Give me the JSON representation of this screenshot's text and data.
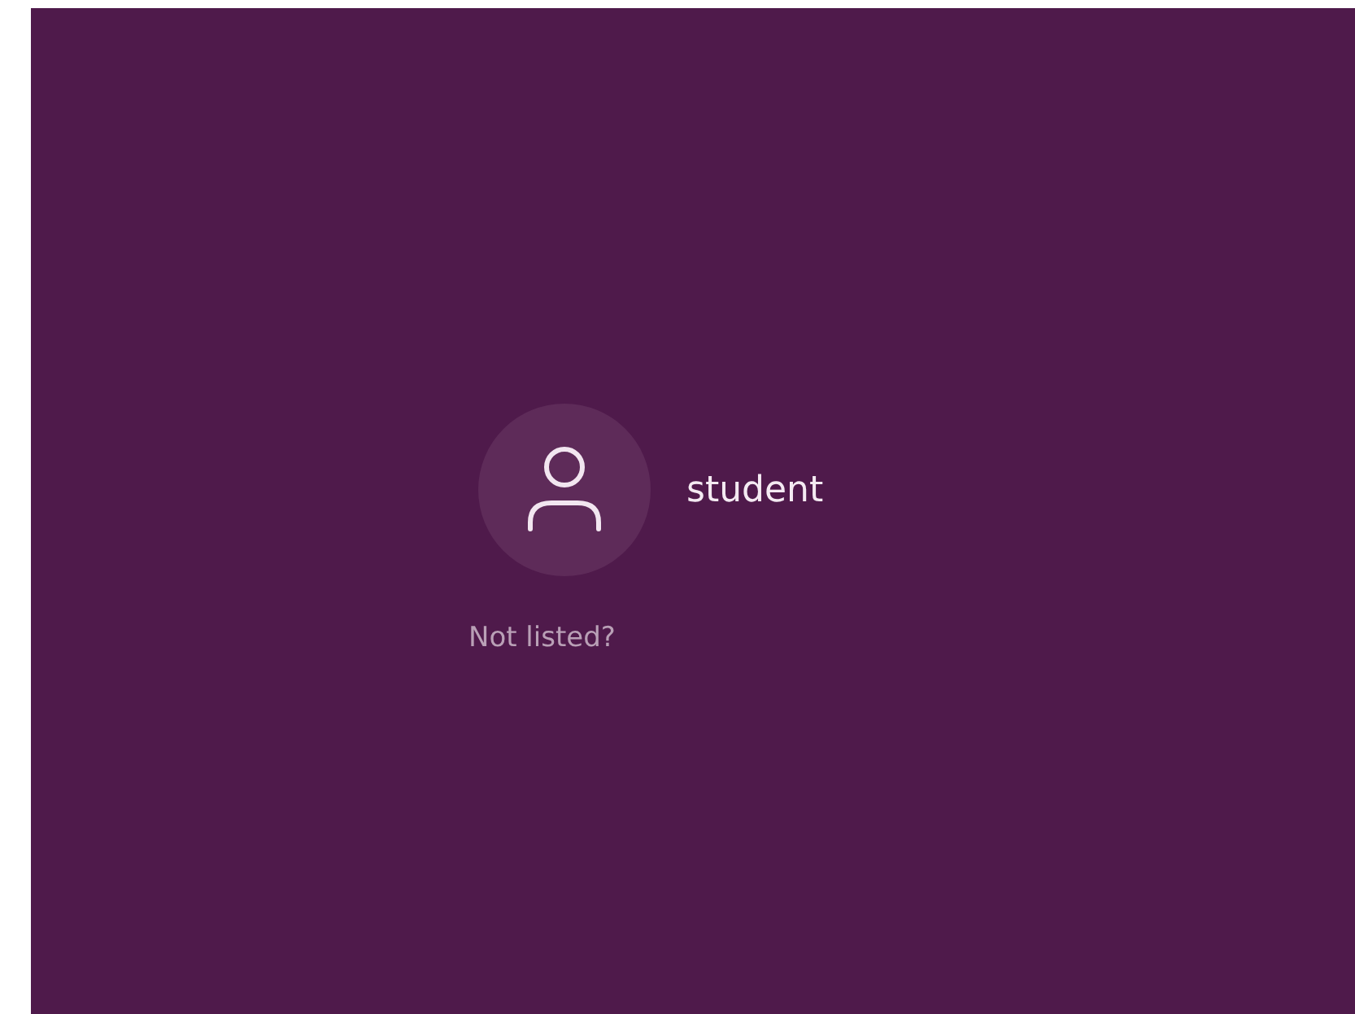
{
  "users": [
    {
      "name": "student",
      "selected": false
    }
  ],
  "not_listed_link": "Not listed?"
}
